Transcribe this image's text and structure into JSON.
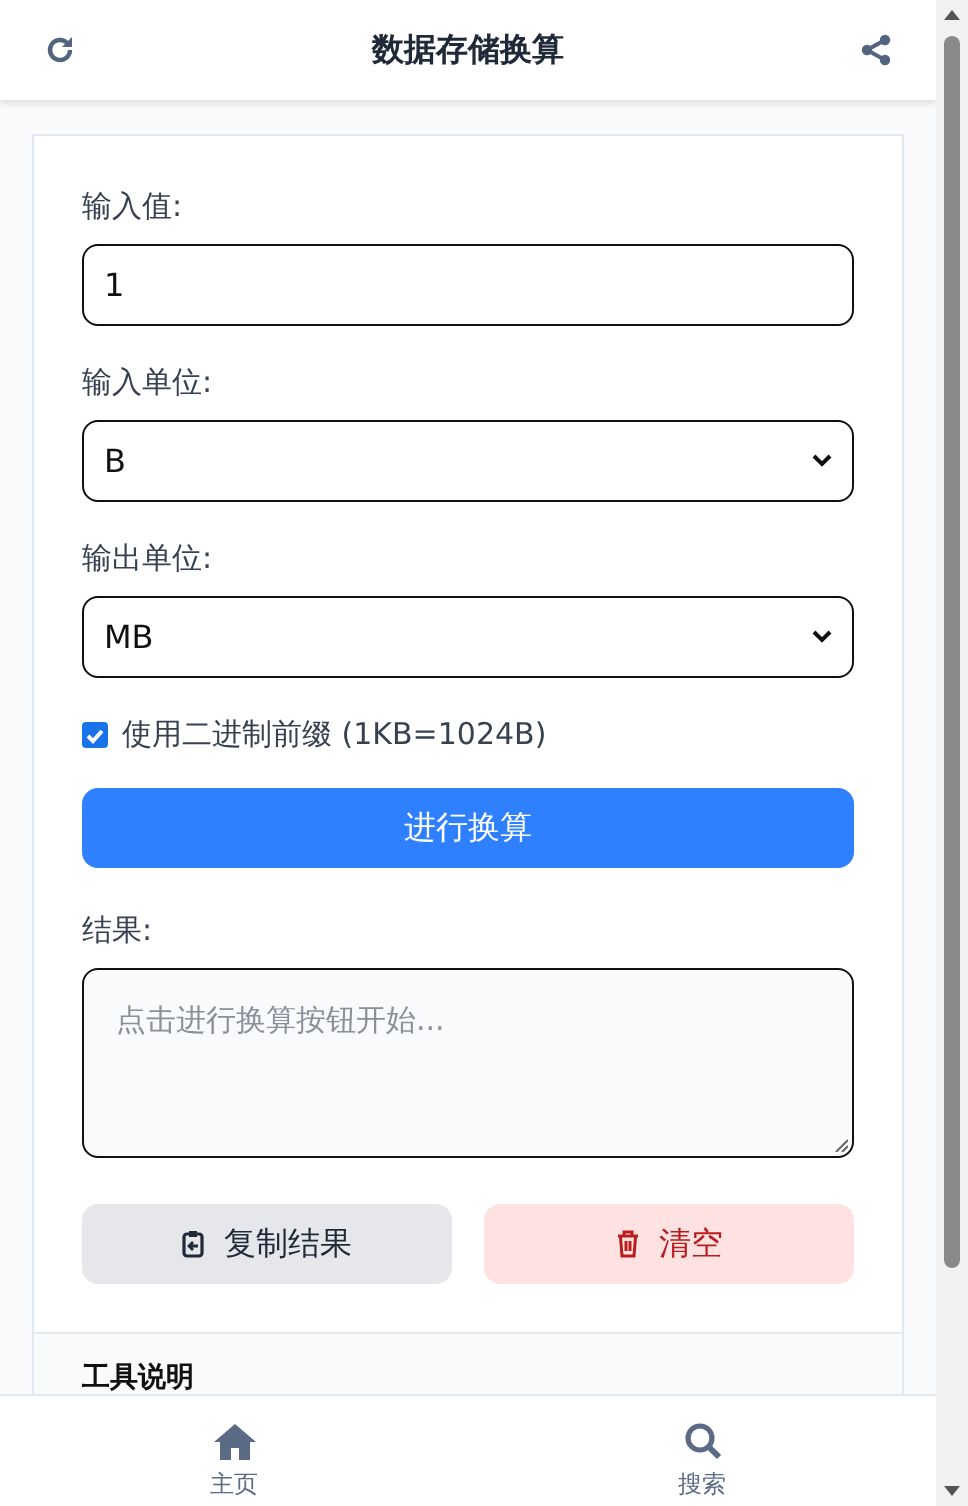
{
  "header": {
    "title": "数据存储换算"
  },
  "form": {
    "input_label": "输入值:",
    "input_value": "1",
    "from_label": "输入单位:",
    "from_unit": "B",
    "to_label": "输出单位:",
    "to_unit": "MB",
    "binary": {
      "label": "使用二进制前缀 (1KB=1024B)",
      "checked": true
    },
    "convert_button": "进行换算",
    "result_label": "结果:",
    "result_placeholder": "点击进行换算按钮开始...",
    "copy_button": "复制结果",
    "clear_button": "清空"
  },
  "info": {
    "title": "工具说明"
  },
  "nav": [
    {
      "label": "主页",
      "kind": "home"
    },
    {
      "label": "搜索",
      "kind": "search"
    }
  ]
}
